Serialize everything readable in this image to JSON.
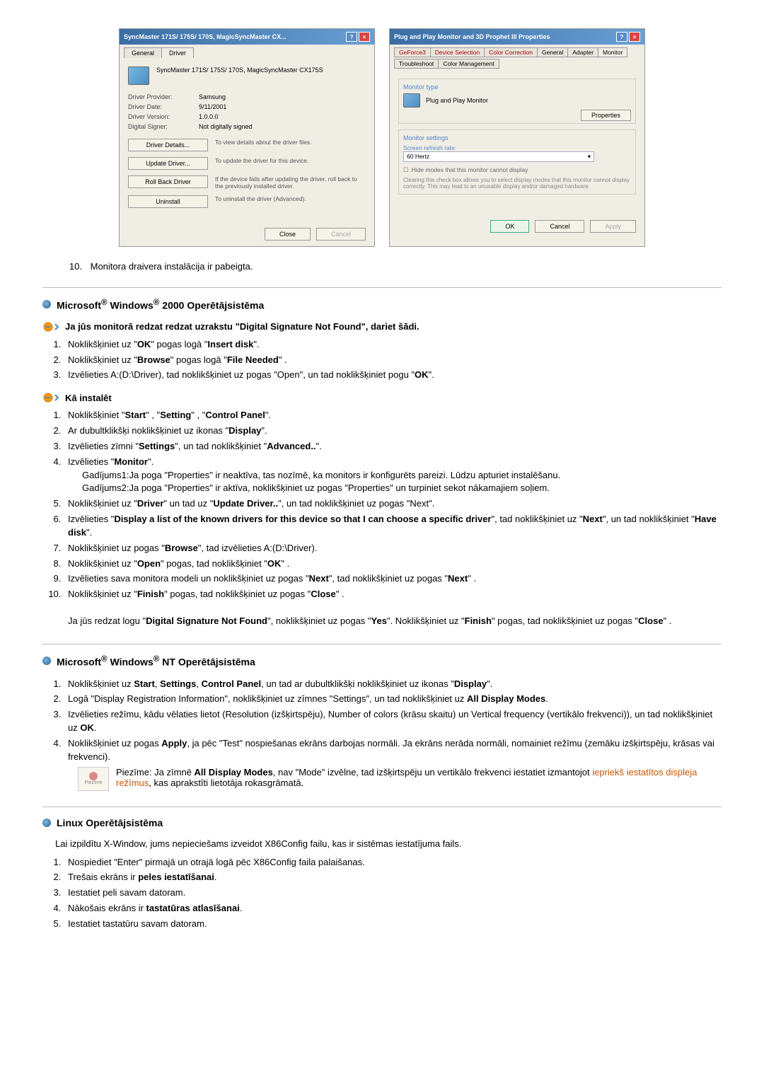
{
  "dialogs": {
    "left": {
      "title": "SyncMaster 171S/ 175S/ 170S, MagicSyncMaster CX...",
      "tabs": {
        "general": "General",
        "driver": "Driver"
      },
      "header_name": "SyncMaster 171S/ 175S/ 170S, MagicSyncMaster CX175S",
      "rows": {
        "provider_label": "Driver Provider:",
        "provider": "Samsung",
        "date_label": "Driver Date:",
        "date": "9/11/2001",
        "version_label": "Driver Version:",
        "version": "1.0.0.0",
        "signer_label": "Digital Signer:",
        "signer": "Not digitally signed"
      },
      "buttons": {
        "details": "Driver Details...",
        "details_desc": "To view details about the driver files.",
        "update": "Update Driver...",
        "update_desc": "To update the driver for this device.",
        "rollback": "Roll Back Driver",
        "rollback_desc": "If the device fails after updating the driver, roll back to the previously installed driver.",
        "uninstall": "Uninstall",
        "uninstall_desc": "To uninstall the driver (Advanced)."
      },
      "footer": {
        "close": "Close",
        "cancel": "Cancel"
      }
    },
    "right": {
      "title": "Plug and Play Monitor and 3D Prophet III Properties",
      "tab_row": {
        "geforce": "GeForce3",
        "devsel": "Device Selection",
        "colorcorr": "Color Correction",
        "general": "General",
        "adapter": "Adapter",
        "monitor": "Monitor",
        "troubleshoot": "Troubleshoot",
        "colormgmt": "Color Management"
      },
      "section1": {
        "label": "Monitor type",
        "text": "Plug and Play Monitor",
        "btn": "Properties"
      },
      "section2": {
        "label": "Monitor settings",
        "refresh_label": "Screen refresh rate:",
        "refresh_value": "60 Hertz",
        "checkbox": "Hide modes that this monitor cannot display",
        "help": "Clearing this check box allows you to select display modes that this monitor cannot display correctly. This may lead to an unusable display and/or damaged hardware."
      },
      "footer": {
        "ok": "OK",
        "cancel": "Cancel",
        "apply": "Apply"
      }
    }
  },
  "step10": {
    "num": "10.",
    "text": "Monitora draivera instalācija ir pabeigta."
  },
  "sections": {
    "win2000": {
      "heading_prefix": "Microsoft",
      "heading_mid": "Windows",
      "heading_suffix": "2000 Operētājsistēma",
      "sub1": "Ja jūs monitorā redzat redzat uzrakstu \"Digital Signature Not Found\", dariet šādi.",
      "sub1_steps": [
        "Noklikšķiniet uz \"<b>OK</b>\" pogas logā \"<b>Insert disk</b>\".",
        "Noklikšķiniet uz \"<b>Browse</b>\" pogas logā \"<b>File Needed</b>\" .",
        "Izvēlieties A:(D:\\Driver), tad noklikšķiniet uz pogas \"Open\", un tad noklikšķiniet pogu \"<b>OK</b>\"."
      ],
      "sub2": "Kā instalēt",
      "sub2_steps": [
        "Noklikšķiniet \"<b>Start</b>\" , \"<b>Setting</b>\" , \"<b>Control Panel</b>\".",
        "Ar dubultklikšķi noklikšķiniet uz ikonas \"<b>Display</b>\".",
        "Izvēlieties zīmni \"<b>Settings</b>\", un tad noklikšķiniet \"<b>Advanced..</b>\".",
        "Izvēlieties \"<b>Monitor</b>\".<br><span class='indent'>Gadījums1:Ja poga \"Properties\" ir neaktīva, tas nozīmē, ka monitors ir konfigurēts pareizi. Lūdzu apturiet instalēšanu.</span><span class='indent'>Gadījums2:Ja poga \"Properties\" ir aktīva, noklikšķiniet uz pogas \"Properties\" un turpiniet sekot nākamajiem soļiem.</span>",
        "Noklikšķiniet uz \"<b>Driver</b>\" un tad uz \"<b>Update Driver..</b>\", un tad noklikšķiniet uz pogas \"Next\".",
        "Izvēlieties \"<b>Display a list of the known drivers for this device so that I can choose a specific driver</b>\", tad noklikšķiniet uz \"<b>Next</b>\", un tad noklikšķiniet \"<b>Have disk</b>\".",
        "Noklikšķiniet uz pogas \"<b>Browse</b>\", tad izvēlieties A:(D:\\Driver).",
        "Noklikšķiniet uz \"<b>Open</b>\" pogas, tad noklikšķiniet \"<b>OK</b>\" .",
        "Izvēlieties sava monitora modeli un noklikšķiniet uz pogas \"<b>Next</b>\", tad noklikšķiniet uz pogas \"<b>Next</b>\" .",
        "Noklikšķiniet uz \"<b>Finish</b>\" pogas, tad noklikšķiniet uz pogas \"<b>Close</b>\" .<br><br>Ja jūs redzat logu \"<b>Digital Signature Not Found</b>\", noklikšķiniet uz pogas \"<b>Yes</b>\". Noklikšķiniet uz \"<b>Finish</b>\" pogas, tad noklikšķiniet uz pogas \"<b>Close</b>\" ."
      ]
    },
    "winnt": {
      "heading_prefix": "Microsoft",
      "heading_mid": "Windows",
      "heading_suffix": "NT Operētājsistēma",
      "steps": [
        "Noklikšķiniet uz <b>Start</b>, <b>Settings</b>, <b>Control Panel</b>, un tad ar dubultklikšķi noklikšķiniet uz ikonas \"<b>Display</b>\".",
        "Logā \"Display Registration Information\", noklikšķiniet uz zīmnes \"Settings\", un tad noklikšķiniet uz <b>All Display Modes</b>.",
        "Izvēlieties režīmu, kādu vēlaties lietot (Resolution (izšķirtspēju), Number of colors (krāsu skaitu) un Vertical frequency (vertikālo frekvenci)), un tad noklikšķiniet uz <b>OK</b>.",
        "Noklikšķiniet uz pogas <b>Apply</b>, ja pēc \"Test\" nospiešanas ekrāns darbojas normāli. Ja ekrāns nerāda normāli, nomainiet režīmu (zemāku izšķirtspēju, krāsas vai frekvenci)."
      ],
      "note": "Piezīme: Ja zīmnē <b>All Display Modes</b>, nav \"Mode\" izvēlne, tad izšķirtspēju un vertikālo frekvenci iestatiet izmantojot <a class='link'>iepriekš iestatītos displeja režīmus</a>, kas aprakstīti lietotāja rokasgrāmatā.",
      "note_icon_label": "Piezīme"
    },
    "linux": {
      "heading": "Linux Operētājsistēma",
      "intro": "Lai izpildītu X-Window, jums nepieciešams izveidot X86Config failu, kas ir sistēmas iestatījuma fails.",
      "steps": [
        "Nospiediet \"Enter\" pirmajā un otrajā logā pēc X86Config faila palaišanas.",
        "Trešais ekrāns ir <b>peles iestatīšanai</b>.",
        "Iestatiet peli savam datoram.",
        "Nākošais ekrāns ir <b>tastatūras atlasīšanai</b>.",
        "Iestatiet tastatūru savam datoram."
      ]
    }
  }
}
